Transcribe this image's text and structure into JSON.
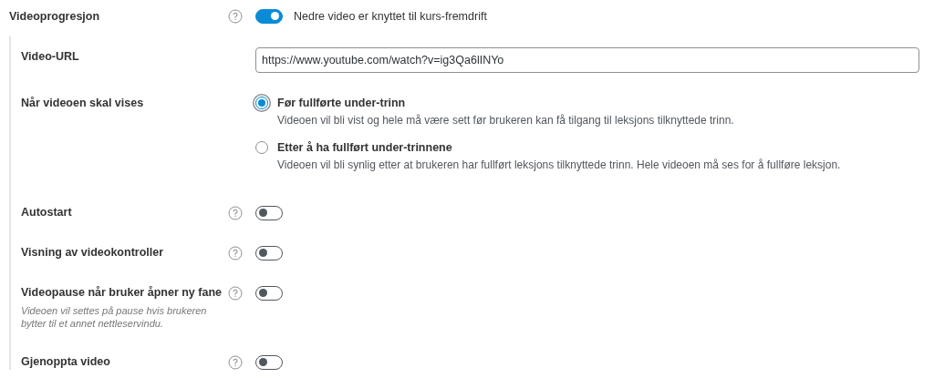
{
  "main_setting": {
    "label": "Videoprogresjon",
    "toggle_on": true,
    "toggle_caption": "Nedre video er knyttet til kurs-fremdrift"
  },
  "section": {
    "rows": [
      {
        "kind": "url",
        "label": "Video-URL",
        "value": "https://www.youtube.com/watch?v=ig3Qa6lINYo"
      },
      {
        "kind": "radio",
        "label": "Når videoen skal vises",
        "options": [
          {
            "title": "Før fullførte under-trinn",
            "description": "Videoen vil bli vist og hele må være sett før brukeren kan få tilgang til leksjons tilknyttede trinn.",
            "selected": true
          },
          {
            "title": "Etter å ha fullført under-trinnene",
            "description": "Videoen vil bli synlig etter at brukeren har fullført leksjons tilknyttede trinn. Hele videoen må ses for å fullføre leksjon.",
            "selected": false
          }
        ]
      },
      {
        "kind": "toggle",
        "label": "Autostart",
        "on": false
      },
      {
        "kind": "toggle",
        "label": "Visning av videokontroller",
        "on": false
      },
      {
        "kind": "toggle",
        "label": "Videopause når bruker åpner ny fane",
        "hint": "Videoen vil settes på pause hvis brukeren bytter til et annet nettleservindu.",
        "on": false
      },
      {
        "kind": "toggle",
        "label": "Gjenoppta video",
        "on": false
      }
    ]
  }
}
